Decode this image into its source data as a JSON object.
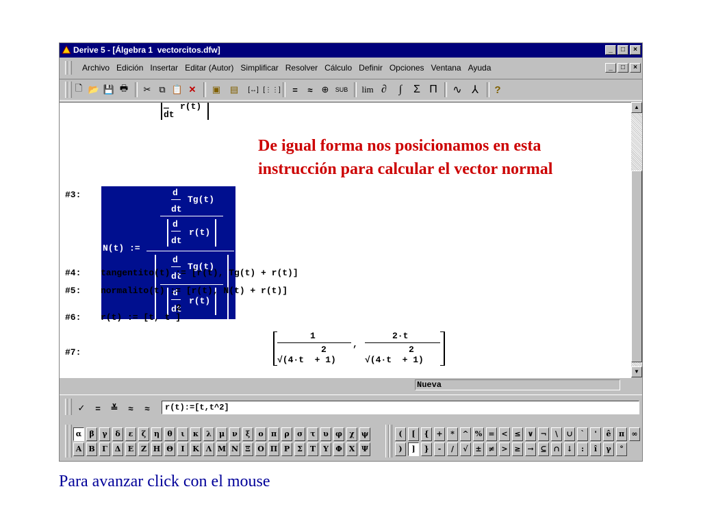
{
  "window": {
    "title": "Derive 5 - [Álgebra 1  vectorcitos.dfw]",
    "control_buttons": [
      "_",
      "□",
      "×"
    ]
  },
  "menu": [
    "Archivo",
    "Edición",
    "Insertar",
    "Editar (Autor)",
    "Simplificar",
    "Resolver",
    "Cálculo",
    "Definir",
    "Opciones",
    "Ventana",
    "Ayuda"
  ],
  "toolbar": {
    "buttons": [
      {
        "icon": "new-file-icon",
        "glyph": "🗋"
      },
      {
        "icon": "open-folder-icon",
        "glyph": "📂"
      },
      {
        "icon": "save-icon",
        "glyph": "💾"
      },
      {
        "icon": "print-icon",
        "glyph": "🖶"
      },
      {
        "icon": "cut-icon",
        "glyph": "✂"
      },
      {
        "icon": "copy-icon",
        "glyph": "⧉"
      },
      {
        "icon": "paste-icon",
        "glyph": "📋"
      },
      {
        "icon": "delete-icon",
        "glyph": "✕"
      },
      {
        "icon": "insert-expression-icon",
        "glyph": "▣"
      },
      {
        "icon": "insert-text-icon",
        "glyph": "▤"
      },
      {
        "icon": "vector-icon",
        "glyph": "[↔]"
      },
      {
        "icon": "matrix-icon",
        "glyph": "[⋮⋮]"
      },
      {
        "icon": "simplify-icon",
        "glyph": "="
      },
      {
        "icon": "approximate-icon",
        "glyph": "≈"
      },
      {
        "icon": "solve-icon",
        "glyph": "⊕"
      },
      {
        "icon": "substitute-icon",
        "glyph": "SUB"
      },
      {
        "icon": "limit-icon",
        "glyph": "lim"
      },
      {
        "icon": "derivative-icon",
        "glyph": "∂"
      },
      {
        "icon": "integral-icon",
        "glyph": "∫"
      },
      {
        "icon": "sum-icon",
        "glyph": "Σ"
      },
      {
        "icon": "product-icon",
        "glyph": "Π"
      },
      {
        "icon": "plot-2d-icon",
        "glyph": "∿"
      },
      {
        "icon": "plot-3d-icon",
        "glyph": "⅄"
      },
      {
        "icon": "help-icon",
        "glyph": "?"
      }
    ]
  },
  "algebra": {
    "top_fragment": {
      "num": "—",
      "den": "dt",
      "expr": "r(t)"
    },
    "expr3": {
      "label": "#3:",
      "lhs": "N(t) :=",
      "d": "d",
      "dt": "dt",
      "tg": "Tg(t)",
      "r": "r(t)"
    },
    "expr4": {
      "label": "#4:",
      "text": "tangentito(t) := [r(t), Tg(t) + r(t)]"
    },
    "expr5": {
      "label": "#5:",
      "text": "normalito(t) := [r(t), N(t) + r(t)]"
    },
    "expr6": {
      "label": "#6:",
      "text": "r(t) := [t, t ]",
      "exp": "2"
    },
    "expr7": {
      "label": "#7:",
      "num1": "1",
      "num2": "2·t",
      "exp1": "2",
      "exp2": "2",
      "den1": "√(4·t  + 1)",
      "den2": "√(4·t  + 1)",
      "comma": ","
    }
  },
  "annotation": {
    "line1": "De igual forma nos posicionamos en esta",
    "line2": "instrucción para calcular el vector normal",
    "color": "#cc0000"
  },
  "status": {
    "text": "Nueva"
  },
  "entry": {
    "tools": [
      "✓",
      "=",
      "≚",
      "≈",
      "≈"
    ],
    "value": "r(t):=[t,t^2]"
  },
  "greek": {
    "row1": [
      "α",
      "β",
      "γ",
      "δ",
      "ε",
      "ζ",
      "η",
      "θ",
      "ι",
      "κ",
      "λ",
      "μ",
      "ν",
      "ξ",
      "ο",
      "π",
      "ρ",
      "σ",
      "τ",
      "υ",
      "φ",
      "χ",
      "ψ"
    ],
    "row2": [
      "Α",
      "Β",
      "Γ",
      "Δ",
      "Ε",
      "Ζ",
      "Η",
      "Θ",
      "Ι",
      "Κ",
      "Λ",
      "Μ",
      "Ν",
      "Ξ",
      "Ο",
      "Π",
      "Ρ",
      "Σ",
      "Τ",
      "Υ",
      "Φ",
      "Χ",
      "Ψ"
    ]
  },
  "symbols": {
    "row1": [
      "(",
      "[",
      "{",
      "+",
      "*",
      "^",
      "%",
      "=",
      "<",
      "≤",
      "∨",
      "¬",
      "\\",
      "∪",
      "`",
      "'",
      "ê",
      "π",
      "∞"
    ],
    "row2": [
      ")",
      "]",
      "}",
      "-",
      "/",
      "√",
      "±",
      "≠",
      ">",
      "≥",
      "→",
      "⊆",
      "∩",
      "↓",
      ":",
      "î",
      "γ",
      "°"
    ]
  },
  "footer": {
    "text": "Para avanzar click con el mouse",
    "color": "#000099"
  }
}
